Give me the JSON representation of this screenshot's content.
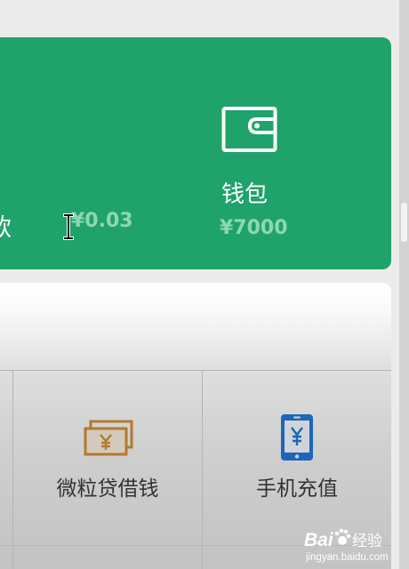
{
  "wallet_card": {
    "partial_label": "款",
    "change_amount": "¥0.03",
    "wallet_label": "钱包",
    "wallet_amount": "¥7000",
    "background_color": "#20a26b",
    "amount_color": "#8fd7b3",
    "icons": {
      "wallet": "wallet-icon",
      "cursor": "text-cursor-icon"
    }
  },
  "services": {
    "items": [
      {
        "label": "微粒贷借钱",
        "icon": "yuan-banknote-icon",
        "icon_color": "#b27a2d"
      },
      {
        "label": "手机充值",
        "icon": "mobile-phone-yuan-icon",
        "icon_color": "#1d66b8"
      }
    ]
  },
  "watermark": {
    "brand": "Bai",
    "brand_suffix": "经验",
    "domain": "jingyan.baidu.com"
  }
}
